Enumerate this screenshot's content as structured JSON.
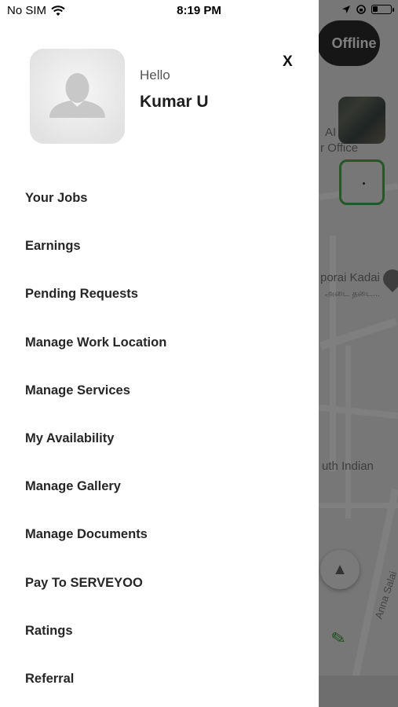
{
  "status_bar": {
    "carrier": "No SIM",
    "time": "8:19 PM"
  },
  "map": {
    "offline_label": "Offline",
    "place_labels": {
      "label1_line1": "AI D",
      "label1_line2": "r Office",
      "label2": "porai Kadai",
      "label2_sub": "அடை தடை...",
      "label3": "uth Indian",
      "road": "Anna Salai"
    }
  },
  "profile": {
    "greeting": "Hello",
    "name": "Kumar U",
    "close_label": "X"
  },
  "menu": {
    "items": [
      {
        "label": "Your Jobs"
      },
      {
        "label": "Earnings"
      },
      {
        "label": "Pending Requests"
      },
      {
        "label": "Manage Work Location"
      },
      {
        "label": "Manage Services"
      },
      {
        "label": "My Availability"
      },
      {
        "label": "Manage Gallery"
      },
      {
        "label": "Manage Documents"
      },
      {
        "label": "Pay To SERVEYOO"
      },
      {
        "label": "Ratings"
      },
      {
        "label": "Referral"
      }
    ]
  },
  "colors": {
    "accent_green": "#4caf50",
    "offline_button": "#2d2d2d"
  }
}
